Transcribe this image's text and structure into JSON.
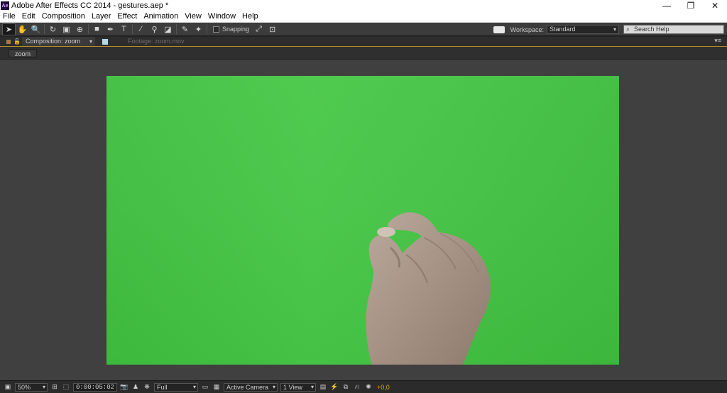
{
  "window": {
    "app_logo": "Ae",
    "title": "Adobe After Effects CC 2014 - gestures.aep *",
    "controls": {
      "minimize": "—",
      "restore": "❐",
      "close": "✕"
    }
  },
  "menu": {
    "items": [
      "File",
      "Edit",
      "Composition",
      "Layer",
      "Effect",
      "Animation",
      "View",
      "Window",
      "Help"
    ]
  },
  "toolbar": {
    "tools": [
      {
        "name": "selection-tool-icon",
        "glyph": "➤",
        "active": true
      },
      {
        "name": "hand-tool-icon",
        "glyph": "✋",
        "active": false
      },
      {
        "name": "zoom-tool-icon",
        "glyph": "🔍",
        "active": false
      },
      {
        "name": "rotate-tool-icon",
        "glyph": "↻",
        "active": false
      },
      {
        "name": "camera-tool-icon",
        "glyph": "▣",
        "active": false
      },
      {
        "name": "pan-behind-tool-icon",
        "glyph": "⊕",
        "active": false
      },
      {
        "name": "rectangle-tool-icon",
        "glyph": "■",
        "active": false
      },
      {
        "name": "pen-tool-icon",
        "glyph": "✒",
        "active": false
      },
      {
        "name": "type-tool-icon",
        "glyph": "T",
        "active": false
      },
      {
        "name": "brush-tool-icon",
        "glyph": "∕",
        "active": false
      },
      {
        "name": "clone-stamp-tool-icon",
        "glyph": "⚲",
        "active": false
      },
      {
        "name": "eraser-tool-icon",
        "glyph": "◪",
        "active": false
      },
      {
        "name": "roto-brush-tool-icon",
        "glyph": "✎",
        "active": false
      },
      {
        "name": "puppet-pin-tool-icon",
        "glyph": "✦",
        "active": false
      }
    ],
    "snapping_label": "Snapping",
    "workspace_label": "Workspace:",
    "workspace_value": "Standard",
    "search_placeholder": "Search Help"
  },
  "panel": {
    "active_tab": "Composition: zoom",
    "inactive_tab": "Footage: zoom.mov",
    "breadcrumb": "zoom",
    "menu_glyph": "▾≡"
  },
  "statusbar": {
    "magnification": "50%",
    "timecode": "0:00:05:02",
    "resolution": "Full",
    "camera": "Active Camera",
    "views": "1 View",
    "exposure": "+0,0"
  }
}
